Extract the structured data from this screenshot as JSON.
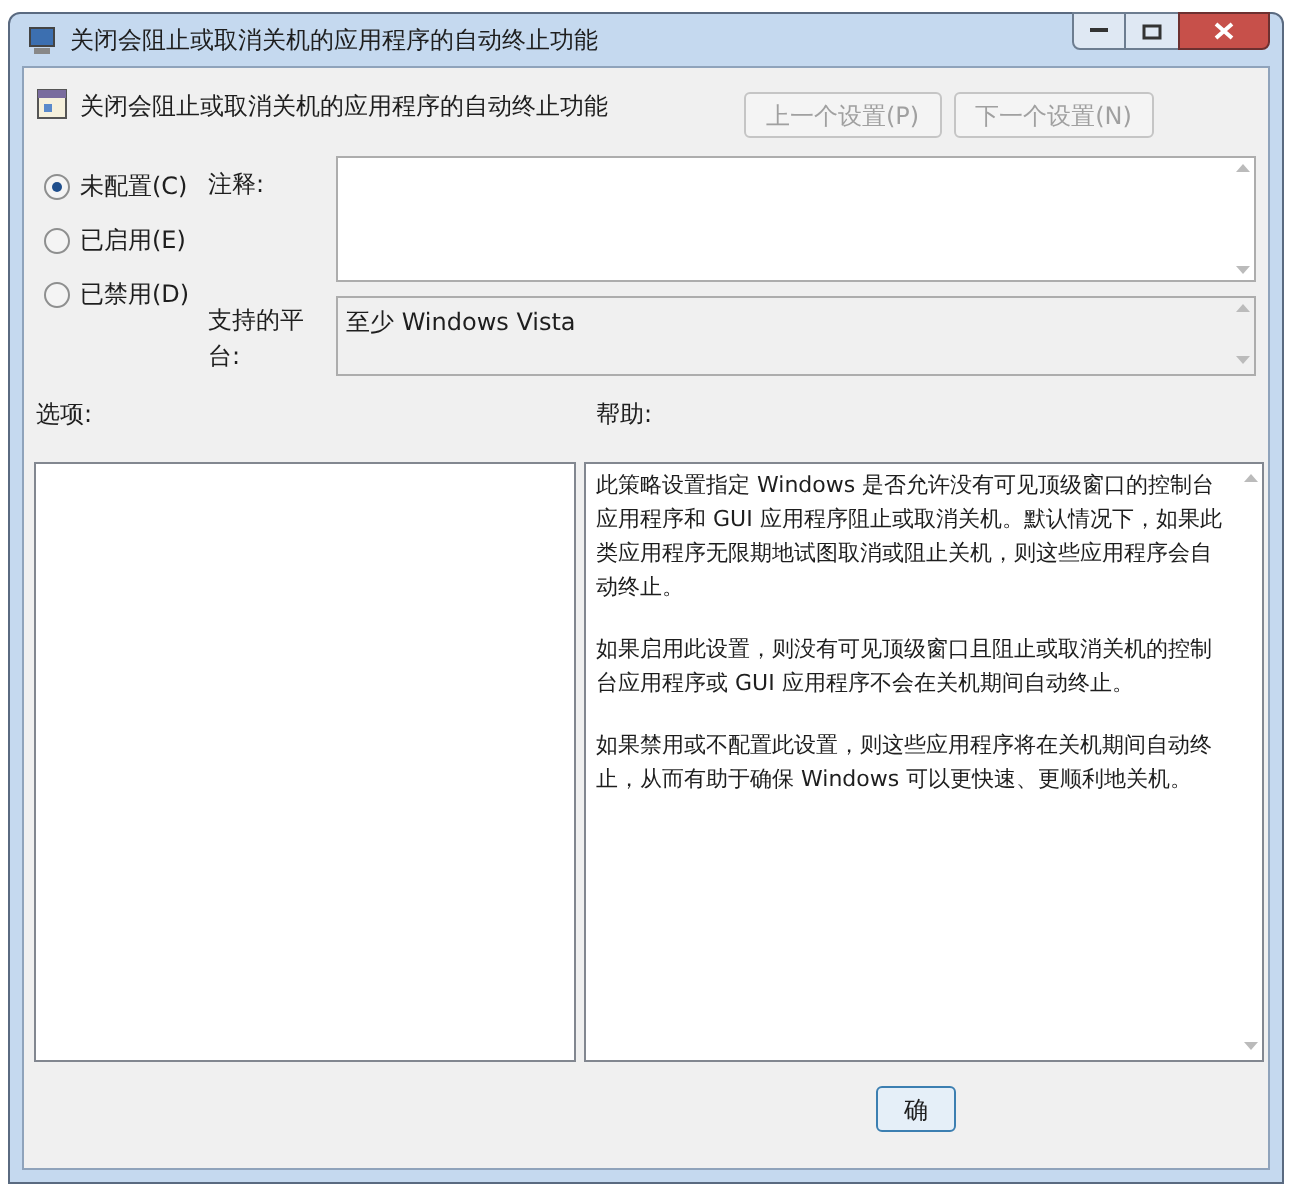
{
  "window": {
    "title": "关闭会阻止或取消关机的应用程序的自动终止功能"
  },
  "header": {
    "title": "关闭会阻止或取消关机的应用程序的自动终止功能",
    "buttons": [
      {
        "label": "上一个设置(P)",
        "disabled": true
      },
      {
        "label": "下一个设置(N)",
        "disabled": true
      }
    ]
  },
  "radios": [
    {
      "label": "未配置(C)",
      "selected": true
    },
    {
      "label": "已启用(E)",
      "selected": false
    },
    {
      "label": "已禁用(D)",
      "selected": false
    }
  ],
  "comment": {
    "label": "注释:"
  },
  "platform": {
    "label": "支持的平台:",
    "value": "至少 Windows Vista"
  },
  "options": {
    "label": "选项:"
  },
  "help": {
    "label": "帮助:",
    "paragraphs": [
      "此策略设置指定 Windows 是否允许没有可见顶级窗口的控制台应用程序和 GUI 应用程序阻止或取消关机。默认情况下，如果此类应用程序无限期地试图取消或阻止关机，则这些应用程序会自动终止。",
      "如果启用此设置，则没有可见顶级窗口且阻止或取消关机的控制台应用程序或 GUI 应用程序不会在关机期间自动终止。",
      "如果禁用或不配置此设置，则这些应用程序将在关机期间自动终止，从而有助于确保 Windows 可以更快速、更顺利地关机。"
    ]
  },
  "footer": {
    "buttons": [
      "确"
    ]
  }
}
